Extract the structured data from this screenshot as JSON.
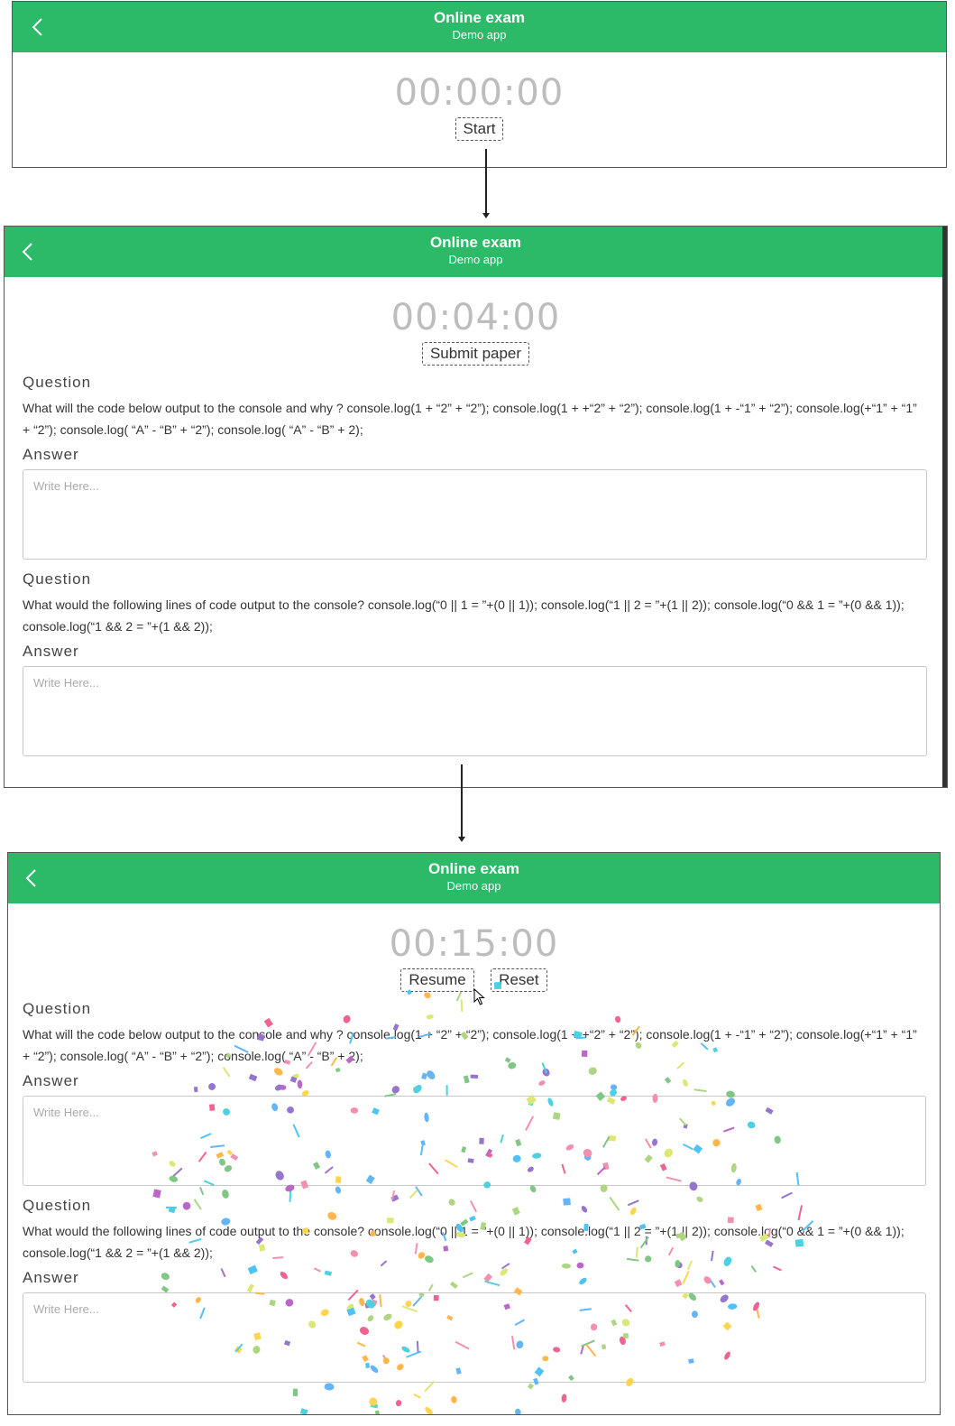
{
  "header": {
    "title": "Online exam",
    "subtitle": "Demo app"
  },
  "screens": [
    {
      "timer": "00:00:00",
      "buttons": [
        "Start"
      ]
    },
    {
      "timer": "00:04:00",
      "buttons": [
        "Submit paper"
      ]
    },
    {
      "timer": "00:15:00",
      "buttons": [
        "Resume",
        "Reset"
      ]
    }
  ],
  "questions": [
    {
      "label": "Question",
      "text": "What will the code below output to the console and why ? console.log(1 + “2” + “2”); console.log(1 + +“2” + “2”); console.log(1 + -“1” + “2”); console.log(+“1” + “1” + “2”); console.log( “A” - “B” + “2”); console.log( “A” - “B” + 2);",
      "answer_label": "Answer",
      "placeholder": "Write Here..."
    },
    {
      "label": "Question",
      "text": "What would the following lines of code output to the console? console.log(“0 || 1 = ”+(0 || 1)); console.log(“1 || 2 = ”+(1 || 2)); console.log(“0 && 1 = ”+(0 && 1)); console.log(“1 && 2 = ”+(1 && 2));",
      "answer_label": "Answer",
      "placeholder": "Write Here..."
    }
  ],
  "colors": {
    "header": "#2dba68",
    "timer": "#bdbdbd"
  },
  "icons": {
    "back": "chevron-left-icon"
  }
}
